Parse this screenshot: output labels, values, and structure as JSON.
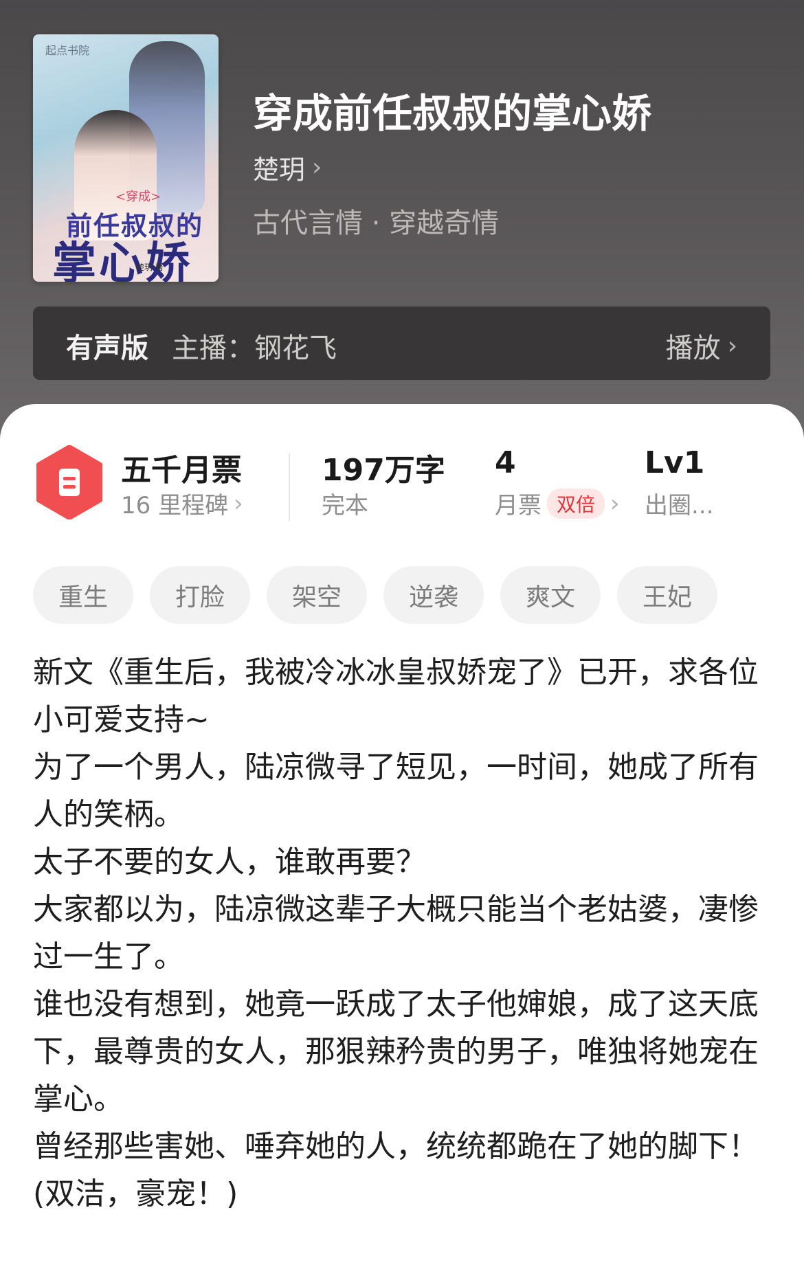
{
  "book": {
    "title": "穿成前任叔叔的掌心娇",
    "author": "楚玥",
    "genre": "古代言情 · 穿越奇情"
  },
  "cover": {
    "publisher_logo": "起点书院",
    "small_text": "<穿成>",
    "line1": "前任叔叔的",
    "line2": "掌心娇",
    "author": "楚玥 著"
  },
  "audio": {
    "label": "有声版",
    "anchor": "主播：钢花飞",
    "play": "播放"
  },
  "stats": {
    "tickets": {
      "title": "五千月票",
      "sub": "16 里程碑"
    },
    "words": {
      "title": "197万字",
      "sub": "完本"
    },
    "monthly": {
      "title": "4",
      "sub": "月票",
      "badge": "双倍"
    },
    "level": {
      "title": "Lv1",
      "sub": "出圈..."
    }
  },
  "tags": [
    "重生",
    "打脸",
    "架空",
    "逆袭",
    "爽文",
    "王妃"
  ],
  "description": [
    "新文《重生后，我被冷冰冰皇叔娇宠了》已开，求各位小可爱支持~",
    "为了一个男人，陆凉微寻了短见，一时间，她成了所有人的笑柄。",
    "太子不要的女人，谁敢再要？",
    "大家都以为，陆凉微这辈子大概只能当个老姑婆，凄惨过一生了。",
    "谁也没有想到，她竟一跃成了太子他婶娘，成了这天底下，最尊贵的女人，那狠辣矜贵的男子，唯独将她宠在掌心。",
    "曾经那些害她、唾弃她的人，统统都跪在了她的脚下！",
    "(双洁，豪宠！)"
  ],
  "colors": {
    "accent": "#f04e50",
    "badge_bg": "#fde6e6",
    "hero_bg": "#4a4849"
  },
  "icons": {
    "ticket": "ticket-icon",
    "chevron": "chevron-right-icon"
  }
}
